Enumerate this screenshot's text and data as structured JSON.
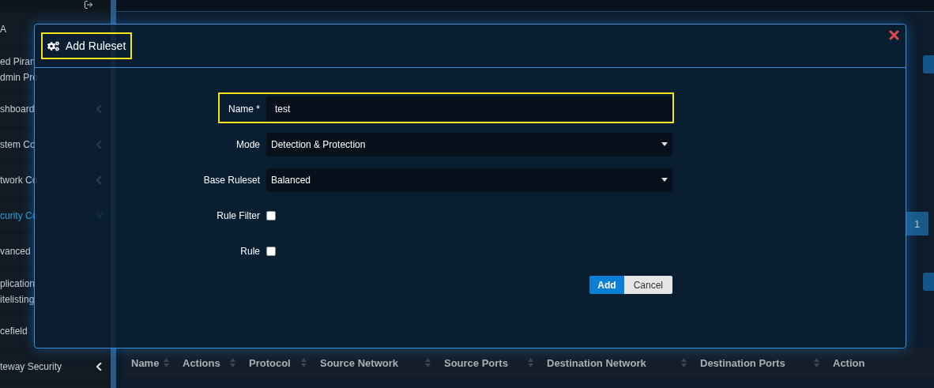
{
  "sidebar": {
    "items": [
      {
        "kind": "plain",
        "label": "A",
        "selected": false
      },
      {
        "kind": "plain",
        "label": "ed Piran\ndmin Pro",
        "selected": false
      },
      {
        "kind": "collapsed",
        "label": "shboard",
        "selected": false
      },
      {
        "kind": "collapsed",
        "label": "stem Co",
        "selected": false
      },
      {
        "kind": "collapsed",
        "label": "twork Co",
        "selected": false
      },
      {
        "kind": "expanded",
        "label": "curity Co",
        "selected": true
      },
      {
        "kind": "plain",
        "label": "vanced",
        "selected": false
      },
      {
        "kind": "plain",
        "label": "plication\nitelisting",
        "selected": false
      },
      {
        "kind": "plain",
        "label": "cefield",
        "selected": false
      },
      {
        "kind": "collapsed",
        "label": "teway Security",
        "selected": false
      }
    ]
  },
  "pagination": {
    "pages": [
      {
        "label": "1",
        "selected": true
      }
    ]
  },
  "table": {
    "columns": [
      {
        "label": "Name",
        "sortable": true
      },
      {
        "label": "Actions",
        "sortable": true
      },
      {
        "label": "Protocol",
        "sortable": true
      },
      {
        "label": "Source Network",
        "sortable": true
      },
      {
        "label": "Source Ports",
        "sortable": true
      },
      {
        "label": "Destination Network",
        "sortable": true
      },
      {
        "label": "Destination Ports",
        "sortable": true
      },
      {
        "label": "Action",
        "sortable": false
      }
    ]
  },
  "dialog": {
    "title": "Add Ruleset",
    "title_highlighted": true,
    "fields": [
      {
        "kind": "text",
        "label": "Name *",
        "value": "test",
        "highlighted": true
      },
      {
        "kind": "select",
        "label": "Mode",
        "value": "Detection & Protection",
        "highlighted": false
      },
      {
        "kind": "select",
        "label": "Base Ruleset",
        "value": "Balanced",
        "highlighted": false
      },
      {
        "kind": "checkbox",
        "label": "Rule Filter",
        "checked": false,
        "highlighted": false
      },
      {
        "kind": "checkbox",
        "label": "Rule",
        "checked": false,
        "highlighted": false
      }
    ],
    "buttons": [
      {
        "kind": "primary",
        "label": "Add"
      },
      {
        "kind": "secondary",
        "label": "Cancel"
      }
    ]
  }
}
